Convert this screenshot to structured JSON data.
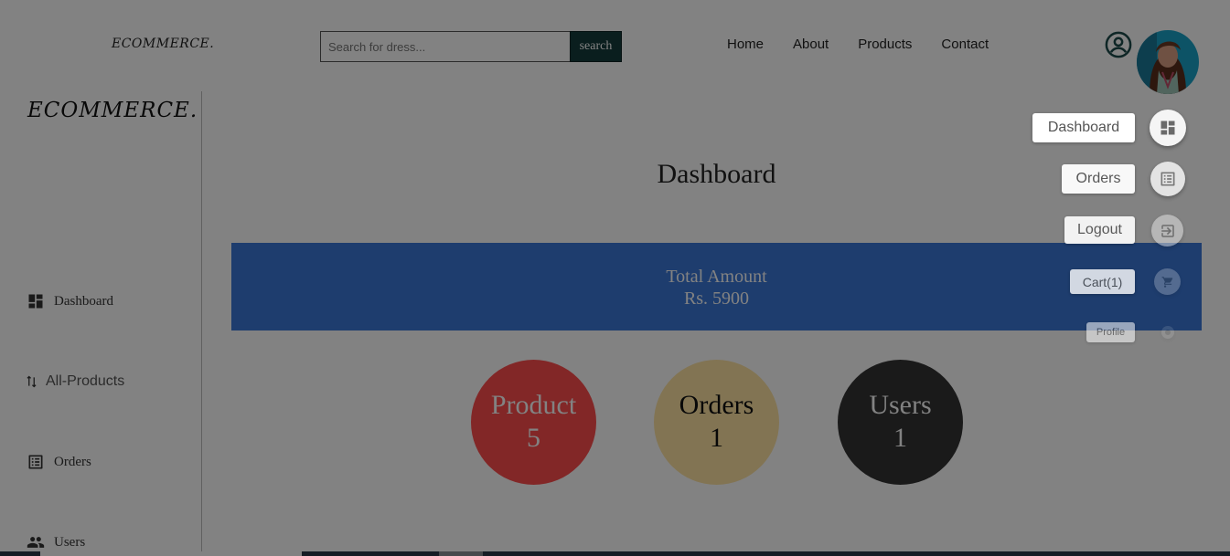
{
  "header": {
    "logo": "ECOMMERCE.",
    "search": {
      "placeholder": "Search for dress...",
      "value": "",
      "button": "search"
    },
    "nav": [
      "Home",
      "About",
      "Products",
      "Contact"
    ]
  },
  "sidebar": {
    "logo": "ECOMMERCE.",
    "items": [
      {
        "label": "Dashboard",
        "icon": "dashboard-icon"
      },
      {
        "label": "All-Products",
        "icon": "sort-arrows-icon"
      },
      {
        "label": "Orders",
        "icon": "list-icon"
      },
      {
        "label": "Users",
        "icon": "people-icon"
      }
    ]
  },
  "main": {
    "title": "Dashboard",
    "total": {
      "label": "Total Amount",
      "value": "Rs. 5900"
    },
    "cards": [
      {
        "label": "Product",
        "count": "5"
      },
      {
        "label": "Orders",
        "count": "1"
      },
      {
        "label": "Users",
        "count": "1"
      }
    ]
  },
  "speed_dial": {
    "actions": [
      {
        "label": "Dashboard",
        "icon": "dashboard-icon"
      },
      {
        "label": "Orders",
        "icon": "list-icon"
      },
      {
        "label": "Logout",
        "icon": "logout-icon"
      },
      {
        "label": "Cart(1)",
        "icon": "cart-icon"
      },
      {
        "label": "Profile",
        "icon": "person-icon"
      }
    ]
  },
  "colors": {
    "total_box": "#3b78d8",
    "product_circle": "#ff4d4d",
    "orders_circle": "#ffe4a4",
    "users_circle": "#333333",
    "search_button": "#143c3c"
  }
}
